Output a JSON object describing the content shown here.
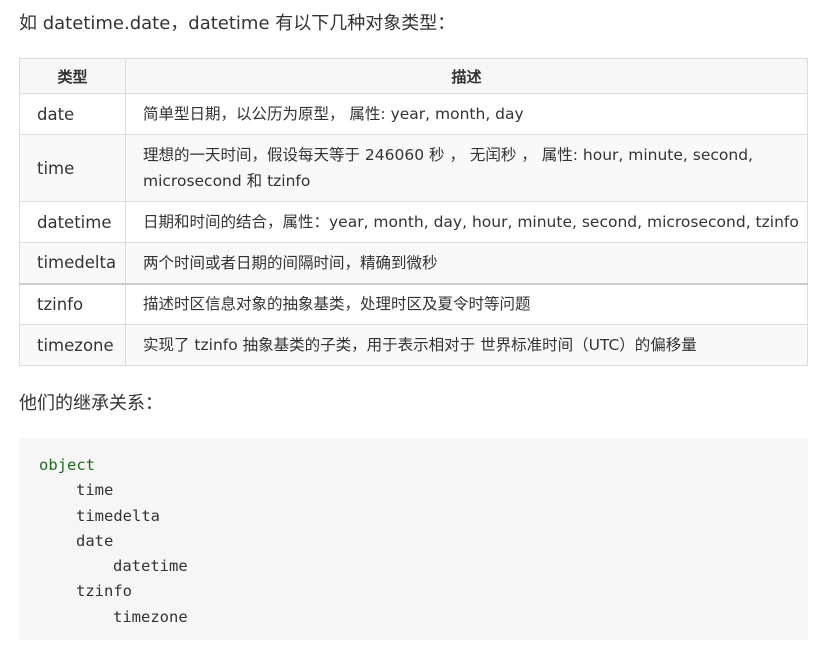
{
  "intro_text": "如 datetime.date，datetime 有以下几种对象类型：",
  "table": {
    "headers": [
      "类型",
      "描述"
    ],
    "rows": [
      {
        "type": "date",
        "desc": "简单型日期，以公历为原型， 属性: year, month, day"
      },
      {
        "type": "time",
        "desc": "理想的一天时间，假设每天等于 246060 秒 ， 无闰秒 ， 属性: hour, minute, second, microsecond 和 tzinfo"
      },
      {
        "type": "datetime",
        "desc": "日期和时间的结合，属性：year, month, day, hour, minute, second, microsecond, tzinfo"
      },
      {
        "type": "timedelta",
        "desc": "两个时间或者日期的间隔时间，精确到微秒"
      },
      {
        "type": "tzinfo",
        "desc": "描述时区信息对象的抽象基类，处理时区及夏令时等问题"
      },
      {
        "type": "timezone",
        "desc": "实现了 tzinfo 抽象基类的子类，用于表示相对于 世界标准时间（UTC）的偏移量"
      }
    ]
  },
  "inherit_text": "他们的继承关系：",
  "code_lines": {
    "object": "object",
    "time": "time",
    "timedelta": "timedelta",
    "date": "date",
    "datetime": "datetime",
    "tzinfo": "tzinfo",
    "timezone": "timezone"
  },
  "colors": {
    "keyword": "#1e6b1e",
    "code_background": "#f6f6f6",
    "table_border": "#dddddd"
  }
}
